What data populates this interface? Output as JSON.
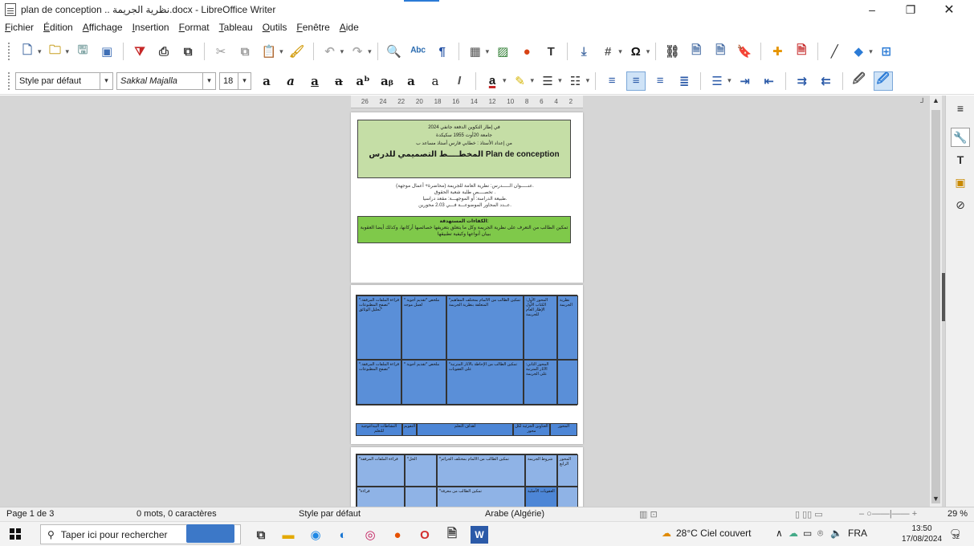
{
  "window": {
    "title": "plan de conception .. نظرية الجريمة.docx - LibreOffice Writer",
    "minimize": "–",
    "maximize": "❐",
    "close": "✕"
  },
  "menu": [
    "Fichier",
    "Édition",
    "Affichage",
    "Insertion",
    "Format",
    "Tableau",
    "Outils",
    "Fenêtre",
    "Aide"
  ],
  "format_toolbar": {
    "paragraph_style": "Style par défaut",
    "font_name": "Sakkal Majalla",
    "font_size": "18"
  },
  "ruler": [
    "26",
    "24",
    "22",
    "20",
    "18",
    "16",
    "14",
    "12",
    "10",
    "8",
    "6",
    "4",
    "2"
  ],
  "page1": {
    "header_line1": "في إطار التكوين الدفعة جانفي 2024",
    "header_line2": "جامعة 20أوت 1955 سكيكدة",
    "header_line3": "من إعداد الأستاذ : خطابي فارس أستاذ مساعد ب",
    "plan_title": "المخطــــط التصميمي للدرس Plan de conception",
    "info_lines": [
      "عنـــــوان الـــــدرس: نظرية العامة للجريمة (محاضرة+ أعمال موجهة).",
      "تخصــــص طلبة شعبة الحقوق .",
      "طبيعة الدراسة: أو الموجهـــة: مقعد دراسيا.",
      "عــدد المحاور الموضوعـــة فـــي 2.03 محورين."
    ],
    "competence_title": "الكفاءات المستهدفة:",
    "competence_text": "تمكين الطالب من التعرف على نظرية الجريمة وكل ما يتعلق بتعريفها خصائصها أركانها، وكذلك أيضا العقوبة ببيان أنواعها وكيفية تطبيقها"
  },
  "page2": {
    "cells": [
      "*قراءة الملفات المرفقة. *تصفح المطبوعات *تحليل الوثائق",
      "* ملخص *تقديم أجوبة لعمل موجه",
      "*تمكين الطالب من الالمام بمختلف المفاهيم المتعلقة بنظرية الجريمة",
      "المحور الأول: الكتاب الأول الإطار العام للجريمة",
      "نظرية الجريمة",
      "*قراءة الملفات المرفقة. *تصفح المطبوعات",
      "* ملخص *تقديم أجوبة",
      "*تمكين الطالب من الإحاطة بالآثار المترتبة على العقوبات",
      "المحور الثاني: الآثار المترتبة على الجريمة",
      ""
    ],
    "footer_row": [
      "النشاطات البيداغوجية للتعلم",
      "التقويم",
      "أهداف التعلم",
      "العناوين الجزئية لكل محور",
      "المحور"
    ]
  },
  "page3": {
    "cells": [
      "*قراءة الملفات المرفقة",
      "*الحل",
      "*تمكين الطالب من الالمام بمختلف الجرائم",
      "شروط الجريمة",
      "المحور الرابع",
      "*قراءة",
      "",
      "*تمكين الطالب من معرفة",
      "العقوبات الأصلية",
      ""
    ]
  },
  "status": {
    "page": "Page 1 de 3",
    "words": "0 mots, 0 caractères",
    "style": "Style par défaut",
    "language": "Arabe (Algérie)",
    "zoom": "29 %"
  },
  "taskbar": {
    "search_placeholder": "Taper ici pour rechercher",
    "weather": "28°C Ciel couvert",
    "language": "FRA",
    "time": "13:50",
    "date": "17/08/2024",
    "notifications": "32"
  }
}
